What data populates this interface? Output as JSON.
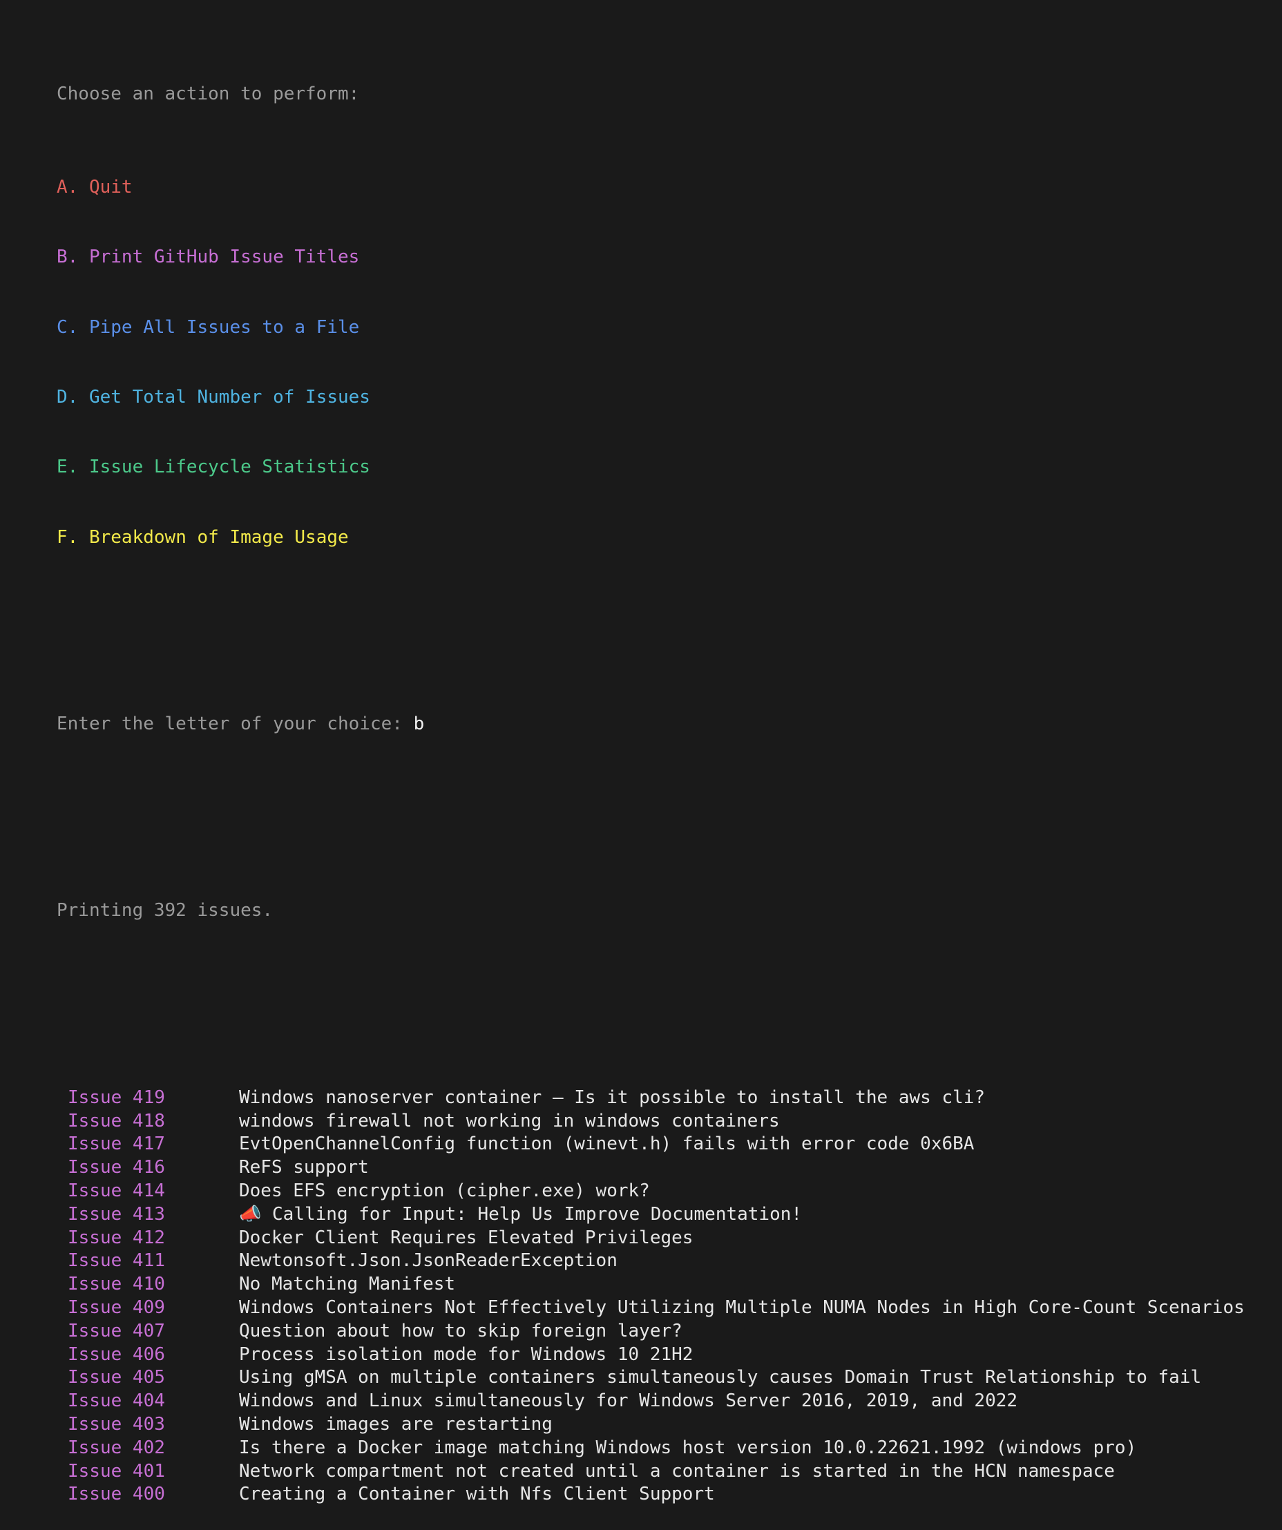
{
  "prompt": {
    "header": "Choose an action to perform:",
    "options": [
      {
        "letter": "A.",
        "label": "Quit",
        "color": "#e0605a"
      },
      {
        "letter": "B.",
        "label": "Print GitHub Issue Titles",
        "color": "#c76fd4"
      },
      {
        "letter": "C.",
        "label": "Pipe All Issues to a File",
        "color": "#5a8fe8"
      },
      {
        "letter": "D.",
        "label": "Get Total Number of Issues",
        "color": "#4fb3e0"
      },
      {
        "letter": "E.",
        "label": "Issue Lifecycle Statistics",
        "color": "#4cc98a"
      },
      {
        "letter": "F.",
        "label": "Breakdown of Image Usage",
        "color": "#f2e94a"
      }
    ],
    "input_label": "Enter the letter of your choice:",
    "input_value": "b",
    "status": "Printing 392 issues."
  },
  "issues": [
    {
      "number": "Issue 419",
      "title": "Windows nanoserver container – Is it possible to install the aws cli?"
    },
    {
      "number": "Issue 418",
      "title": "windows firewall not working in windows containers"
    },
    {
      "number": "Issue 417",
      "title": "EvtOpenChannelConfig function (winevt.h) fails with error code 0x6BA"
    },
    {
      "number": "Issue 416",
      "title": "ReFS support"
    },
    {
      "number": "Issue 414",
      "title": "Does EFS encryption (cipher.exe) work?"
    },
    {
      "number": "Issue 413",
      "title": "📣 Calling for Input: Help Us Improve Documentation!"
    },
    {
      "number": "Issue 412",
      "title": "Docker Client Requires Elevated Privileges"
    },
    {
      "number": "Issue 411",
      "title": "Newtonsoft.Json.JsonReaderException"
    },
    {
      "number": "Issue 410",
      "title": "No Matching Manifest"
    },
    {
      "number": "Issue 409",
      "title": "Windows Containers Not Effectively Utilizing Multiple NUMA Nodes in High Core-Count Scenarios"
    },
    {
      "number": "Issue 407",
      "title": "Question about how to skip foreign layer?"
    },
    {
      "number": "Issue 406",
      "title": "Process isolation mode for Windows 10 21H2"
    },
    {
      "number": "Issue 405",
      "title": "Using gMSA on multiple containers simultaneously causes Domain Trust Relationship to fail"
    },
    {
      "number": "Issue 404",
      "title": "Windows and Linux simultaneously for Windows Server 2016, 2019, and 2022"
    },
    {
      "number": "Issue 403",
      "title": "Windows images are restarting"
    },
    {
      "number": "Issue 402",
      "title": "Is there a Docker image matching Windows host version 10.0.22621.1992 (windows pro)"
    },
    {
      "number": "Issue 401",
      "title": "Network compartment not created until a container is started in the HCN namespace"
    },
    {
      "number": "Issue 400",
      "title": "Creating a Container with Nfs Client Support"
    }
  ]
}
